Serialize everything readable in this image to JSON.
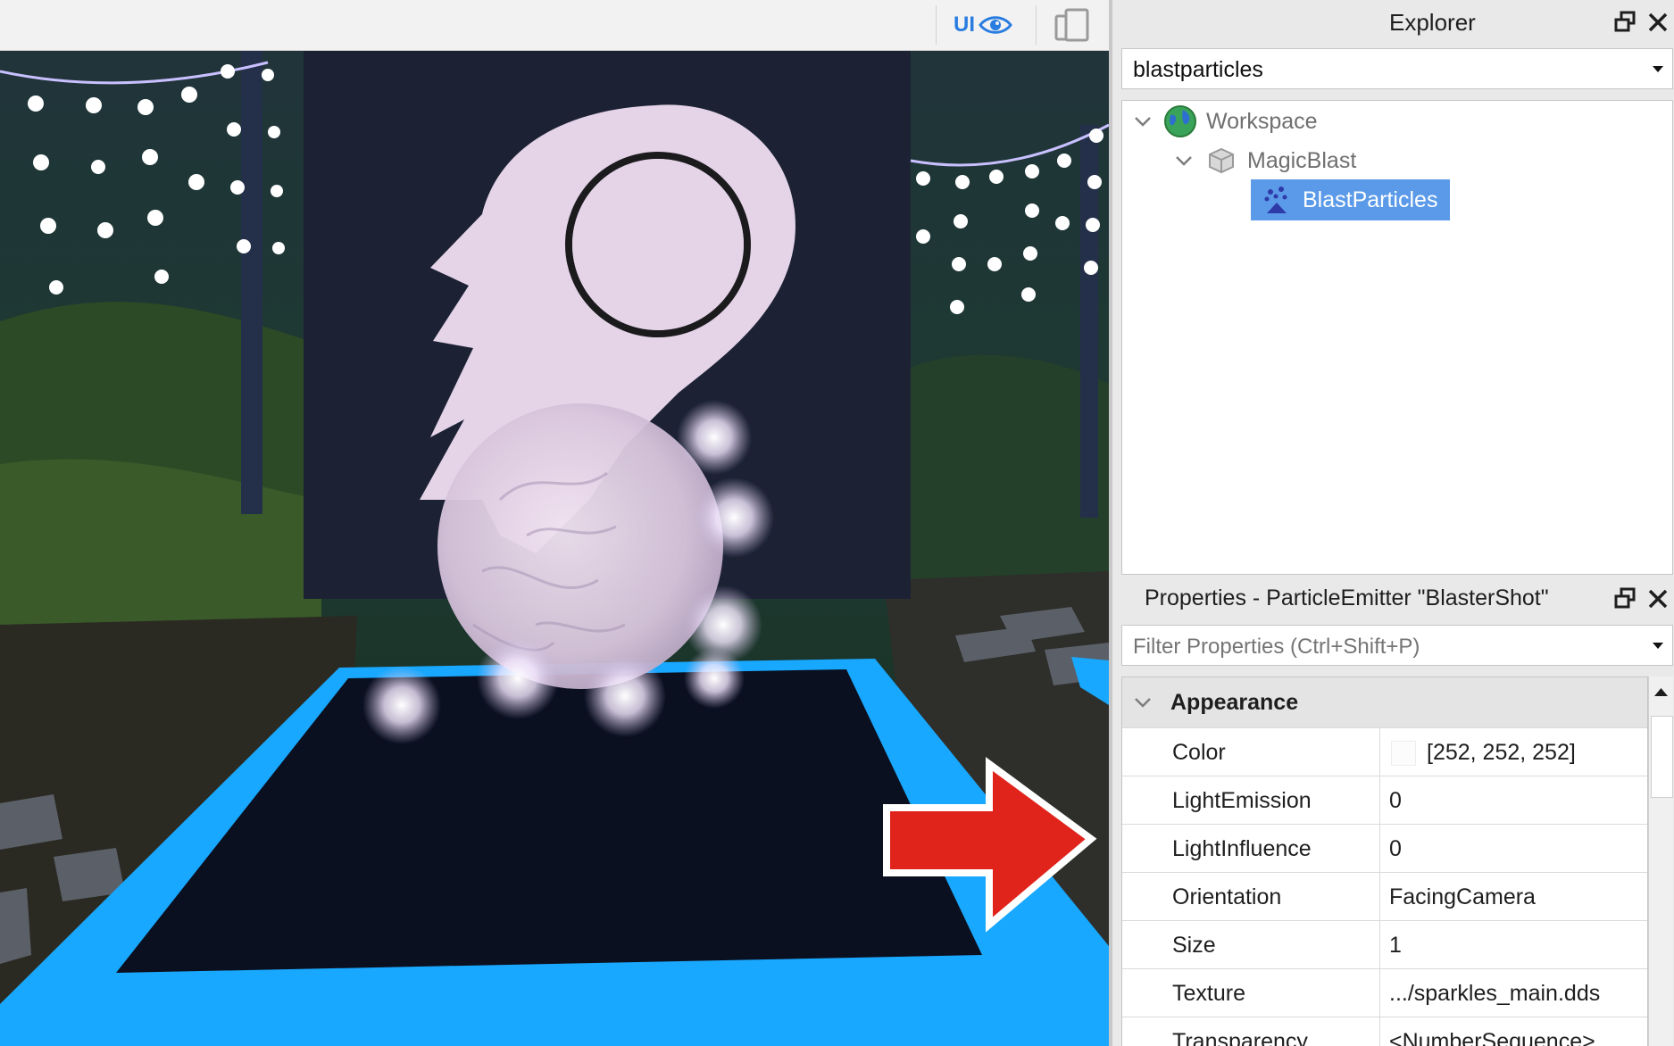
{
  "viewport": {
    "ui_toggle_label": "UI"
  },
  "explorer": {
    "title": "Explorer",
    "filter_value": "blastparticles",
    "tree": [
      {
        "label": "Workspace",
        "icon": "globe-icon",
        "expanded": true
      },
      {
        "label": "MagicBlast",
        "icon": "model-icon",
        "expanded": true
      },
      {
        "label": "BlastParticles",
        "icon": "particle-emitter-icon",
        "selected": true
      }
    ]
  },
  "properties": {
    "title": "Properties - ParticleEmitter \"BlasterShot\"",
    "filter_placeholder": "Filter Properties (Ctrl+Shift+P)",
    "section": "Appearance",
    "rows": [
      {
        "name": "Color",
        "value": "[252, 252, 252]",
        "swatch": "#fcfcfc"
      },
      {
        "name": "LightEmission",
        "value": "0"
      },
      {
        "name": "LightInfluence",
        "value": "0"
      },
      {
        "name": "Orientation",
        "value": "FacingCamera"
      },
      {
        "name": "Size",
        "value": "1"
      },
      {
        "name": "Texture",
        "value": ".../sparkles_main.dds"
      },
      {
        "name": "Transparency",
        "value": "<NumberSequence>"
      }
    ]
  },
  "colors": {
    "selection": "#5b9ae8",
    "accent_blue": "#2a7de0",
    "neon_floor": "#19a8ff",
    "arrow": "#e0231b"
  }
}
